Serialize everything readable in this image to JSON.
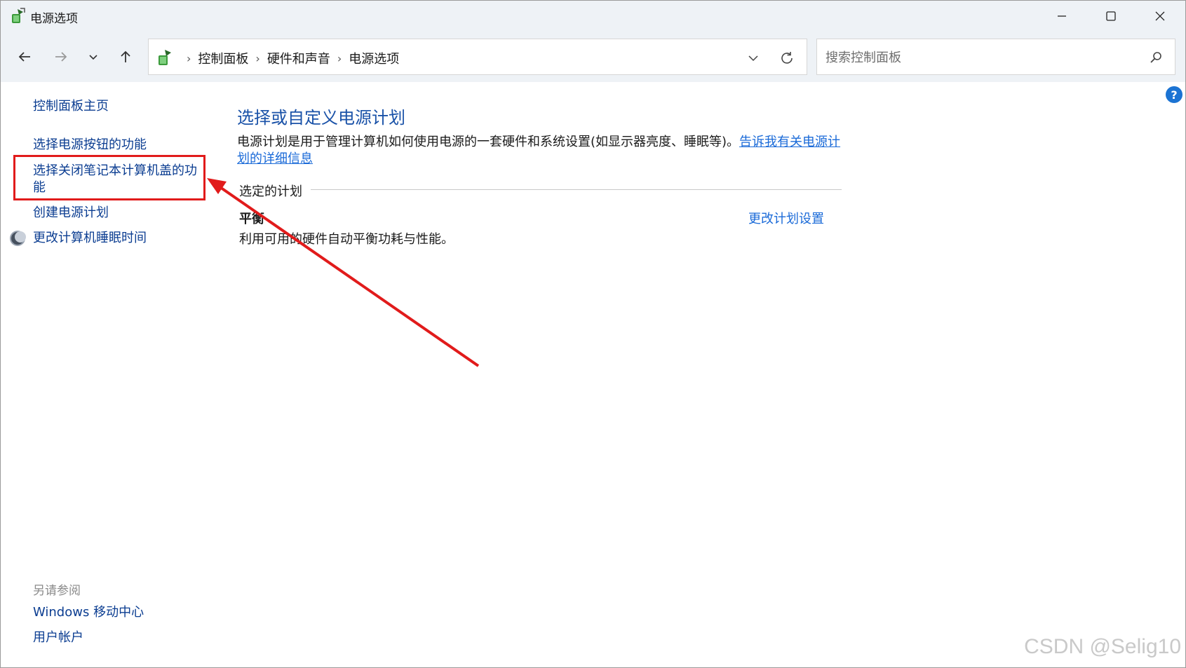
{
  "window": {
    "title": "电源选项",
    "controls": {
      "minimize": "minimize-icon",
      "maximize": "maximize-icon",
      "close": "close-icon"
    }
  },
  "toolbar": {
    "breadcrumbs": [
      "控制面板",
      "硬件和声音",
      "电源选项"
    ],
    "search_placeholder": "搜索控制面板"
  },
  "sidebar": {
    "home": "控制面板主页",
    "items": [
      "选择电源按钮的功能",
      "选择关闭笔记本计算机盖的功能",
      "创建电源计划",
      "更改计算机睡眠时间"
    ],
    "see_also_heading": "另请参阅",
    "see_also": [
      "Windows 移动中心",
      "用户帐户"
    ]
  },
  "main": {
    "title": "选择或自定义电源计划",
    "description": "电源计划是用于管理计算机如何使用电源的一套硬件和系统设置(如显示器亮度、睡眠等)。",
    "description_link": "告诉我有关电源计划的详细信息",
    "selected_plan_label": "选定的计划",
    "plan": {
      "name": "平衡",
      "desc": "利用可用的硬件自动平衡功耗与性能。",
      "change_link": "更改计划设置"
    }
  },
  "annotation": {
    "box_color": "#e11b1b",
    "arrow_color": "#e11b1b"
  },
  "watermark": "CSDN @Selig10"
}
